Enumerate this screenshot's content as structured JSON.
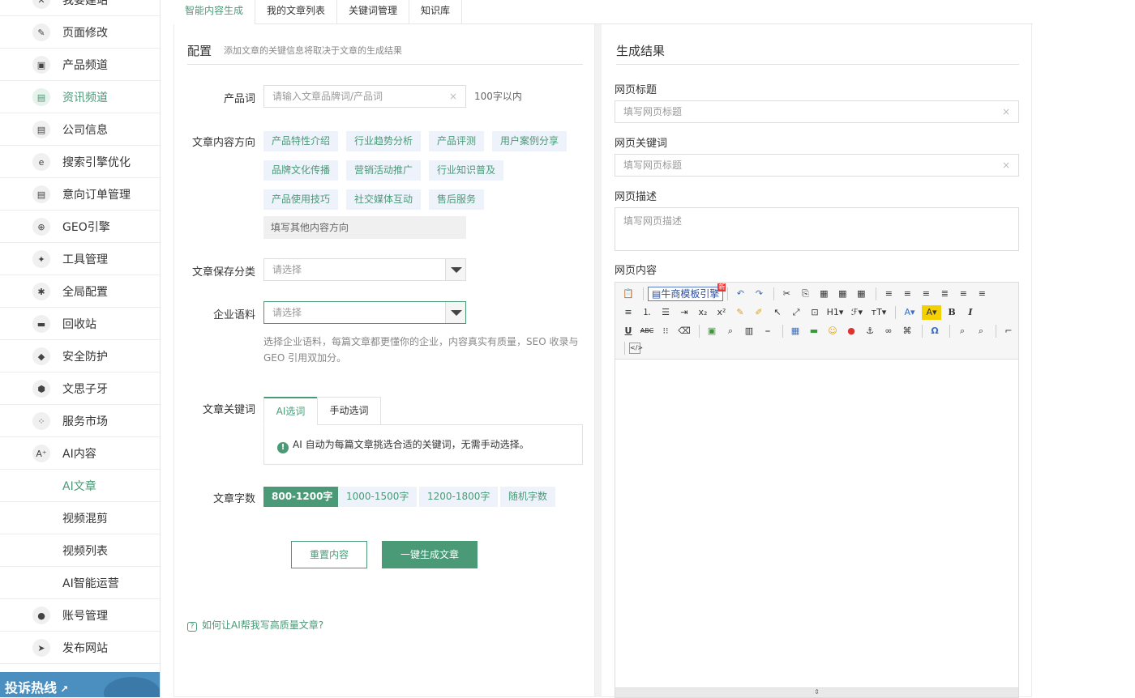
{
  "sidebar": {
    "items": [
      {
        "label": "我要建站",
        "icon": "close-icon",
        "glyph": "✕"
      },
      {
        "label": "页面修改",
        "icon": "pencil-icon",
        "glyph": "✎"
      },
      {
        "label": "产品频道",
        "icon": "bag-icon",
        "glyph": "▣"
      },
      {
        "label": "资讯频道",
        "icon": "news-icon",
        "glyph": "▤",
        "active": true
      },
      {
        "label": "公司信息",
        "icon": "document-icon",
        "glyph": "▤"
      },
      {
        "label": "搜索引擎优化",
        "icon": "browser-icon",
        "glyph": "e"
      },
      {
        "label": "意向订单管理",
        "icon": "order-icon",
        "glyph": "▤"
      },
      {
        "label": "GEO引擎",
        "icon": "globe-icon",
        "glyph": "⊕"
      },
      {
        "label": "工具管理",
        "icon": "wrench-icon",
        "glyph": "✦"
      },
      {
        "label": "全局配置",
        "icon": "settings-icon",
        "glyph": "✱"
      },
      {
        "label": "回收站",
        "icon": "trash-icon",
        "glyph": "▬"
      },
      {
        "label": "安全防护",
        "icon": "shield-icon",
        "glyph": "◆"
      },
      {
        "label": "文思子牙",
        "icon": "hexagon-icon",
        "glyph": "⬢"
      },
      {
        "label": "服务市场",
        "icon": "grid-icon",
        "glyph": "⁘"
      },
      {
        "label": "AI内容",
        "icon": "ai-icon",
        "glyph": "A⁺"
      }
    ],
    "sub_items": [
      {
        "label": "AI文章",
        "active": true
      },
      {
        "label": "视频混剪"
      },
      {
        "label": "视频列表"
      },
      {
        "label": "AI智能运营"
      }
    ],
    "bottom_items": [
      {
        "label": "账号管理",
        "icon": "user-icon",
        "glyph": "●"
      },
      {
        "label": "发布网站",
        "icon": "send-icon",
        "glyph": "➤"
      }
    ],
    "hotline": "投诉热线"
  },
  "tabs": [
    "智能内容生成",
    "我的文章列表",
    "关键词管理",
    "知识库"
  ],
  "config": {
    "title": "配置",
    "subtitle": "添加文章的关键信息将取决于文章的生成结果",
    "product_label": "产品词",
    "product_placeholder": "请输入文章品牌词/产品词",
    "product_limit": "100字以内",
    "direction_label": "文章内容方向",
    "directions": [
      "产品特性介绍",
      "行业趋势分析",
      "产品评测",
      "用户案例分享",
      "品牌文化传播",
      "营销活动推广",
      "行业知识普及",
      "产品使用技巧",
      "社交媒体互动",
      "售后服务"
    ],
    "direction_other": "填写其他内容方向",
    "category_label": "文章保存分类",
    "category_placeholder": "请选择",
    "corpus_label": "企业语料",
    "corpus_placeholder": "请选择",
    "corpus_hint": "选择企业语料，每篇文章都更懂你的企业，内容真实有质量，SEO 收录与 GEO 引用双加分。",
    "keyword_label": "文章关键词",
    "keyword_tabs": [
      "AI选词",
      "手动选词"
    ],
    "keyword_info": "AI 自动为每篇文章挑选合适的关键词，无需手动选择。",
    "wordcount_label": "文章字数",
    "wordcounts": [
      "800-1200字",
      "1000-1500字",
      "1200-1800字",
      "随机字数"
    ],
    "reset_button": "重置内容",
    "generate_button": "一键生成文章",
    "help_link": "如何让AI帮我写高质量文章?"
  },
  "result": {
    "title": "生成结果",
    "page_title_label": "网页标题",
    "page_title_placeholder": "填写网页标题",
    "keywords_label": "网页关键词",
    "keywords_placeholder": "填写网页标题",
    "desc_label": "网页描述",
    "desc_placeholder": "填写网页描述",
    "content_label": "网页内容",
    "template_button": "牛商模板引擎",
    "template_badge": "新"
  },
  "colors": {
    "accent": "#4a9a77",
    "chip_bg": "#eef2fb",
    "hotline_bg": "#4a8fbf"
  }
}
